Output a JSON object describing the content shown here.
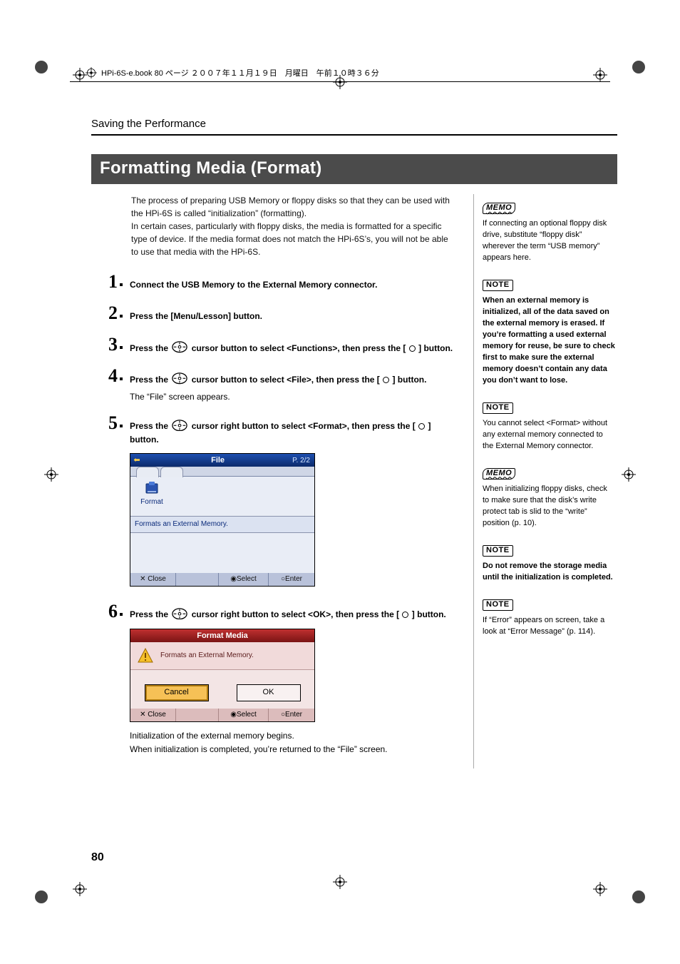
{
  "print_header": "HPi-6S-e.book  80 ページ  ２００７年１１月１９日　月曜日　午前１０時３６分",
  "section_header": "Saving the Performance",
  "title": "Formatting Media (Format)",
  "intro_p1": "The process of preparing USB Memory or floppy disks so that they can be used with the HPi-6S is called “initialization” (formatting).",
  "intro_p2": "In certain cases, particularly with floppy disks, the media is formatted for a specific type of device. If the media format does not match the HPi-6S’s, you will not be able to use that media with the HPi-6S.",
  "steps": {
    "s1": "Connect the USB Memory to the External Memory connector.",
    "s2": "Press the [Menu/Lesson] button.",
    "s3_a": "Press the ",
    "s3_b": " cursor button to select <Functions>, then press the [",
    "s3_c": "] button.",
    "s4_a": "Press the ",
    "s4_b": " cursor button to select <File>, then press the [",
    "s4_c": "] button.",
    "s4_sub": "The “File” screen appears.",
    "s5_a": "Press the ",
    "s5_b": " cursor right button to select <Format>, then press the [",
    "s5_c": "] button.",
    "s6_a": "Press the ",
    "s6_b": " cursor right button to select <OK>, then press the [",
    "s6_c": "] button.",
    "s6_after1": "Initialization of the external memory begins.",
    "s6_after2": "When initialization is completed, you’re returned to the “File” screen."
  },
  "ui_file": {
    "title": "File",
    "page": "P. 2/2",
    "icon_label": "Format",
    "desc": "Formats an External Memory.",
    "close": "✕ Close",
    "select": "◉Select",
    "enter": "○Enter"
  },
  "ui_fmt": {
    "title": "Format Media",
    "msg": "Formats an External Memory.",
    "cancel": "Cancel",
    "ok": "OK",
    "close": "✕ Close",
    "select": "◉Select",
    "enter": "○Enter"
  },
  "side": {
    "memo1": "If connecting an optional floppy disk drive, substitute “floppy disk” wherever the term “USB memory” appears here.",
    "note1": "When an external memory is initialized, all of the data saved on the external memory is erased. If you’re formatting a used external memory for reuse, be sure to check first to make sure the external memory doesn’t contain any data you don’t want to lose.",
    "note2": "You cannot select <Format> without any external memory connected to the External Memory connector.",
    "memo2": "When initializing floppy disks, check to make sure that the disk’s write protect tab is slid to the “write” position (p. 10).",
    "note3": "Do not remove the storage media until the initialization is completed.",
    "note4": "If “Error” appears on screen, take a look at “Error Message” (p. 114)."
  },
  "labels": {
    "memo": "MEMO",
    "note": "NOTE"
  },
  "page_number": "80"
}
